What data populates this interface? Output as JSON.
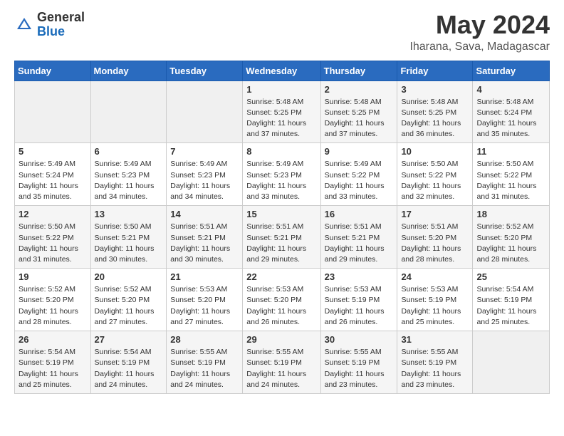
{
  "header": {
    "logo_general": "General",
    "logo_blue": "Blue",
    "month": "May 2024",
    "location": "Iharana, Sava, Madagascar"
  },
  "days_of_week": [
    "Sunday",
    "Monday",
    "Tuesday",
    "Wednesday",
    "Thursday",
    "Friday",
    "Saturday"
  ],
  "weeks": [
    [
      {
        "day": "",
        "info": ""
      },
      {
        "day": "",
        "info": ""
      },
      {
        "day": "",
        "info": ""
      },
      {
        "day": "1",
        "info": "Sunrise: 5:48 AM\nSunset: 5:25 PM\nDaylight: 11 hours\nand 37 minutes."
      },
      {
        "day": "2",
        "info": "Sunrise: 5:48 AM\nSunset: 5:25 PM\nDaylight: 11 hours\nand 37 minutes."
      },
      {
        "day": "3",
        "info": "Sunrise: 5:48 AM\nSunset: 5:25 PM\nDaylight: 11 hours\nand 36 minutes."
      },
      {
        "day": "4",
        "info": "Sunrise: 5:48 AM\nSunset: 5:24 PM\nDaylight: 11 hours\nand 35 minutes."
      }
    ],
    [
      {
        "day": "5",
        "info": "Sunrise: 5:49 AM\nSunset: 5:24 PM\nDaylight: 11 hours\nand 35 minutes."
      },
      {
        "day": "6",
        "info": "Sunrise: 5:49 AM\nSunset: 5:23 PM\nDaylight: 11 hours\nand 34 minutes."
      },
      {
        "day": "7",
        "info": "Sunrise: 5:49 AM\nSunset: 5:23 PM\nDaylight: 11 hours\nand 34 minutes."
      },
      {
        "day": "8",
        "info": "Sunrise: 5:49 AM\nSunset: 5:23 PM\nDaylight: 11 hours\nand 33 minutes."
      },
      {
        "day": "9",
        "info": "Sunrise: 5:49 AM\nSunset: 5:22 PM\nDaylight: 11 hours\nand 33 minutes."
      },
      {
        "day": "10",
        "info": "Sunrise: 5:50 AM\nSunset: 5:22 PM\nDaylight: 11 hours\nand 32 minutes."
      },
      {
        "day": "11",
        "info": "Sunrise: 5:50 AM\nSunset: 5:22 PM\nDaylight: 11 hours\nand 31 minutes."
      }
    ],
    [
      {
        "day": "12",
        "info": "Sunrise: 5:50 AM\nSunset: 5:22 PM\nDaylight: 11 hours\nand 31 minutes."
      },
      {
        "day": "13",
        "info": "Sunrise: 5:50 AM\nSunset: 5:21 PM\nDaylight: 11 hours\nand 30 minutes."
      },
      {
        "day": "14",
        "info": "Sunrise: 5:51 AM\nSunset: 5:21 PM\nDaylight: 11 hours\nand 30 minutes."
      },
      {
        "day": "15",
        "info": "Sunrise: 5:51 AM\nSunset: 5:21 PM\nDaylight: 11 hours\nand 29 minutes."
      },
      {
        "day": "16",
        "info": "Sunrise: 5:51 AM\nSunset: 5:21 PM\nDaylight: 11 hours\nand 29 minutes."
      },
      {
        "day": "17",
        "info": "Sunrise: 5:51 AM\nSunset: 5:20 PM\nDaylight: 11 hours\nand 28 minutes."
      },
      {
        "day": "18",
        "info": "Sunrise: 5:52 AM\nSunset: 5:20 PM\nDaylight: 11 hours\nand 28 minutes."
      }
    ],
    [
      {
        "day": "19",
        "info": "Sunrise: 5:52 AM\nSunset: 5:20 PM\nDaylight: 11 hours\nand 28 minutes."
      },
      {
        "day": "20",
        "info": "Sunrise: 5:52 AM\nSunset: 5:20 PM\nDaylight: 11 hours\nand 27 minutes."
      },
      {
        "day": "21",
        "info": "Sunrise: 5:53 AM\nSunset: 5:20 PM\nDaylight: 11 hours\nand 27 minutes."
      },
      {
        "day": "22",
        "info": "Sunrise: 5:53 AM\nSunset: 5:20 PM\nDaylight: 11 hours\nand 26 minutes."
      },
      {
        "day": "23",
        "info": "Sunrise: 5:53 AM\nSunset: 5:19 PM\nDaylight: 11 hours\nand 26 minutes."
      },
      {
        "day": "24",
        "info": "Sunrise: 5:53 AM\nSunset: 5:19 PM\nDaylight: 11 hours\nand 25 minutes."
      },
      {
        "day": "25",
        "info": "Sunrise: 5:54 AM\nSunset: 5:19 PM\nDaylight: 11 hours\nand 25 minutes."
      }
    ],
    [
      {
        "day": "26",
        "info": "Sunrise: 5:54 AM\nSunset: 5:19 PM\nDaylight: 11 hours\nand 25 minutes."
      },
      {
        "day": "27",
        "info": "Sunrise: 5:54 AM\nSunset: 5:19 PM\nDaylight: 11 hours\nand 24 minutes."
      },
      {
        "day": "28",
        "info": "Sunrise: 5:55 AM\nSunset: 5:19 PM\nDaylight: 11 hours\nand 24 minutes."
      },
      {
        "day": "29",
        "info": "Sunrise: 5:55 AM\nSunset: 5:19 PM\nDaylight: 11 hours\nand 24 minutes."
      },
      {
        "day": "30",
        "info": "Sunrise: 5:55 AM\nSunset: 5:19 PM\nDaylight: 11 hours\nand 23 minutes."
      },
      {
        "day": "31",
        "info": "Sunrise: 5:55 AM\nSunset: 5:19 PM\nDaylight: 11 hours\nand 23 minutes."
      },
      {
        "day": "",
        "info": ""
      }
    ]
  ]
}
